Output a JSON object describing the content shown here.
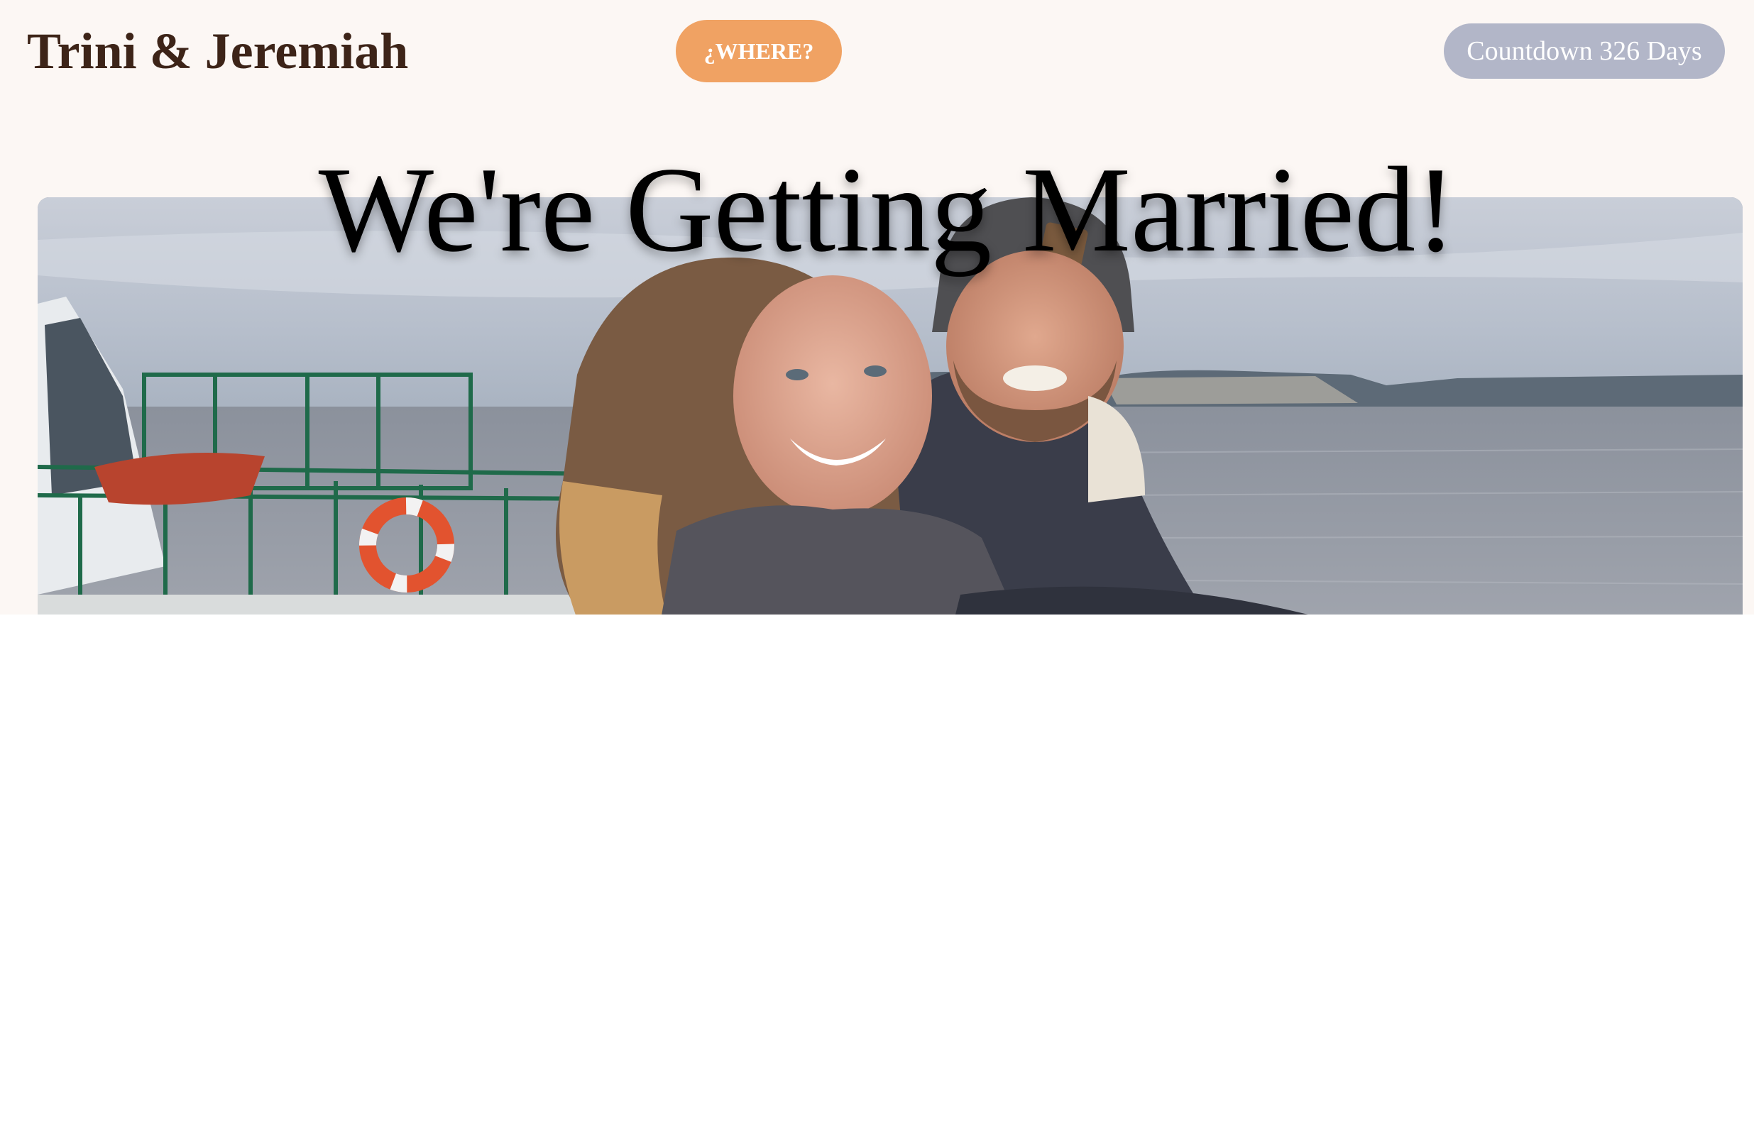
{
  "header": {
    "site_title": "Trini & Jeremiah",
    "where_button": "¿WHERE?",
    "countdown": "Countdown 326 Days"
  },
  "hero": {
    "heading": "We're Getting Married!",
    "photo_alt": "Trini and Jeremiah smiling on a ferry deck"
  },
  "colors": {
    "header_background": "#fcf7f4",
    "title_text": "#3d2418",
    "where_button_bg": "#f0a263",
    "countdown_bg": "#b2b6c8"
  }
}
